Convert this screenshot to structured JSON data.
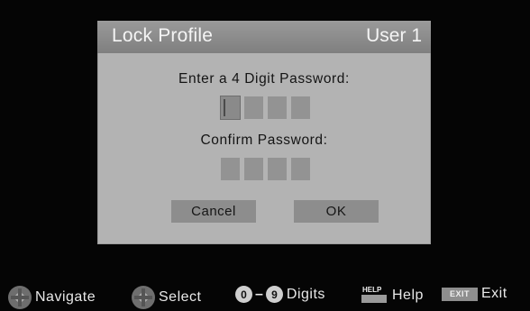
{
  "dialog": {
    "title": "Lock Profile",
    "user": "User 1",
    "enter_label": "Enter a 4 Digit Password:",
    "confirm_label": "Confirm Password:",
    "cancel_label": "Cancel",
    "ok_label": "OK"
  },
  "footer": {
    "navigate": "Navigate",
    "select": "Select",
    "digit_from": "0",
    "dash": "–",
    "digit_to": "9",
    "digits": "Digits",
    "help_key": "HELP",
    "help": "Help",
    "exit_key": "EXIT",
    "exit": "Exit"
  },
  "icons": [
    "dpad-icon",
    "help-key-icon",
    "exit-key-icon"
  ]
}
